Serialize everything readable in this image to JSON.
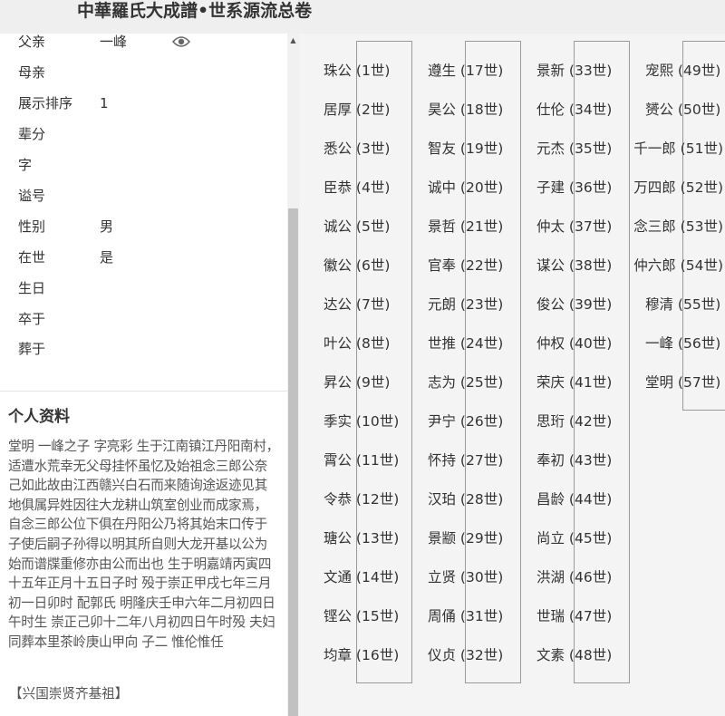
{
  "header": {
    "title": "中華羅氏大成譜•世系源流总卷"
  },
  "person_info": [
    {
      "label": "父亲",
      "value": "一峰"
    },
    {
      "label": "母亲",
      "value": ""
    },
    {
      "label": "展示排序",
      "value": "1"
    },
    {
      "label": "辈分",
      "value": ""
    },
    {
      "label": "字",
      "value": ""
    },
    {
      "label": "谥号",
      "value": ""
    },
    {
      "label": "性别",
      "value": "男"
    },
    {
      "label": "在世",
      "value": "是"
    },
    {
      "label": "生日",
      "value": ""
    },
    {
      "label": "卒于",
      "value": ""
    },
    {
      "label": "葬于",
      "value": ""
    }
  ],
  "icons": {
    "view": "eye-icon",
    "scroll_up": "triangle-up-icon"
  },
  "bio": {
    "heading": "个人资料",
    "text": "堂明 一峰之子 字亮彩 生于江南镇江丹阳南村，适遭水荒幸无父母挂怀虽忆及始祖念三郎公奈己如此故由江西赣兴白石而来随询途返迹见其地俱属异姓因往大龙耕山筑室创业而成家焉，自念三郎公位下俱在丹阳公乃将其始末口传于子使后嗣子孙得以明其所自则大龙开基以公为始而谱牒重修亦由公而出也 生于明嘉靖丙寅四十五年正月十五日子时 殁于崇正甲戌七年三月初一日卯时 配郭氏 明隆庆壬申六年二月初四日午时生 崇正己卯十二年八月初四日午时殁 夫妇同葬本里茶岭庚山甲向 子二 惟伦惟任",
    "link": "【兴国崇贤齐基祖】"
  },
  "lineage": [
    [
      "珠公 (1世)",
      "居厚 (2世)",
      "悉公 (3世)",
      "臣恭 (4世)",
      "诚公 (5世)",
      "徽公 (6世)",
      "达公 (7世)",
      "叶公 (8世)",
      "昇公 (9世)",
      "季实 (10世)",
      "霄公 (11世)",
      "令恭 (12世)",
      "瑭公 (13世)",
      "文通 (14世)",
      "铿公 (15世)",
      "均章 (16世)"
    ],
    [
      "遵生 (17世)",
      "昊公 (18世)",
      "智友 (19世)",
      "诚中 (20世)",
      "景哲 (21世)",
      "官奉 (22世)",
      "元朗 (23世)",
      "世推 (24世)",
      "志为 (25世)",
      "尹宁 (26世)",
      "怀持 (27世)",
      "汉珀 (28世)",
      "景颛 (29世)",
      "立贤 (30世)",
      "周俑 (31世)",
      "仪贞 (32世)"
    ],
    [
      "景新 (33世)",
      "仕伦 (34世)",
      "元杰 (35世)",
      "子建 (36世)",
      "仲太 (37世)",
      "谋公 (38世)",
      "俊公 (39世)",
      "仲权 (40世)",
      "荣庆 (41世)",
      "思珩 (42世)",
      "奉初 (43世)",
      "昌龄 (44世)",
      "尚立 (45世)",
      "洪湖 (46世)",
      "世瑞 (47世)",
      "文素 (48世)"
    ],
    [
      "宠熙 (49世)",
      "赟公 (50世)",
      "千一郎 (51世)",
      "万四郎 (52世)",
      "念三郎 (53世)",
      "仲六郎 (54世)",
      "穆清 (55世)",
      "一峰 (56世)",
      "堂明 (57世)"
    ]
  ]
}
